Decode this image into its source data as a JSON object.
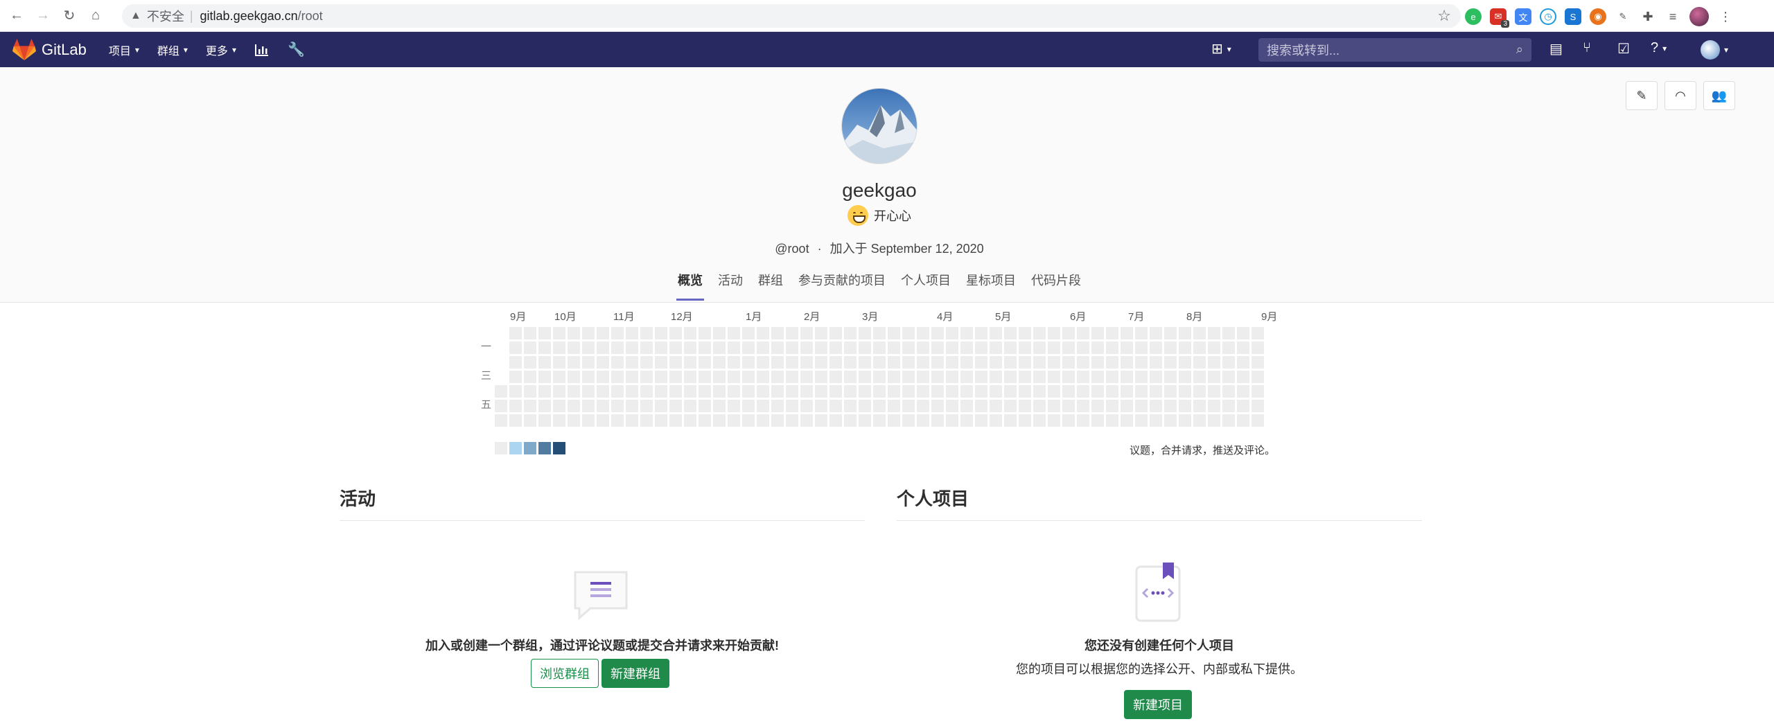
{
  "browser": {
    "insecure_label": "不安全",
    "url_host": "gitlab.geekgao.cn",
    "url_path": "/root",
    "extension_badge": "3"
  },
  "navbar": {
    "brand": "GitLab",
    "menu": [
      {
        "label": "项目"
      },
      {
        "label": "群组"
      },
      {
        "label": "更多"
      }
    ],
    "search_placeholder": "搜索或转到..."
  },
  "profile": {
    "username": "geekgao",
    "status_text": "开心心",
    "handle": "@root",
    "joined": "加入于 September 12, 2020"
  },
  "tabs": [
    {
      "label": "概览",
      "active": true
    },
    {
      "label": "活动"
    },
    {
      "label": "群组"
    },
    {
      "label": "参与贡献的项目"
    },
    {
      "label": "个人项目"
    },
    {
      "label": "星标项目"
    },
    {
      "label": "代码片段"
    }
  ],
  "calendar": {
    "months": [
      "9月",
      "10月",
      "11月",
      "12月",
      "1月",
      "2月",
      "3月",
      "4月",
      "5月",
      "6月",
      "7月",
      "8月",
      "9月"
    ],
    "day_labels": [
      "一",
      "三",
      "五"
    ],
    "legend_colors": [
      "#ededed",
      "#acd5f2",
      "#7fa8c9",
      "#527ba0",
      "#254e77"
    ],
    "legend_text": "议题，合并请求，推送及评论。"
  },
  "activity": {
    "title": "活动",
    "empty_message": "加入或创建一个群组，通过评论议题或提交合并请求来开始贡献!",
    "browse_groups_label": "浏览群组",
    "new_group_label": "新建群组"
  },
  "personal_projects": {
    "title": "个人项目",
    "empty_title": "您还没有创建任何个人项目",
    "empty_description": "您的项目可以根据您的选择公开、内部或私下提供。",
    "new_project_label": "新建项目"
  },
  "colors": {
    "navbar_bg": "#292961",
    "primary_green": "#1f8a4a",
    "tab_underline": "#6666c4"
  }
}
